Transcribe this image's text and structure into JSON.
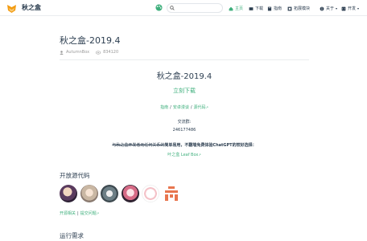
{
  "nav": {
    "site_name": "秋之盒",
    "search_placeholder": "",
    "items": [
      {
        "label": "主页",
        "active": true
      },
      {
        "label": "下载"
      },
      {
        "label": "指南"
      },
      {
        "label": "拓展模块"
      },
      {
        "label": "关于"
      },
      {
        "label": "开发"
      }
    ]
  },
  "page": {
    "title": "秋之盒-2019.4",
    "author": "AutumnBox",
    "views": "834120"
  },
  "content": {
    "heading": "秋之盒-2019.4",
    "download": "立刻下载",
    "links": [
      "指南",
      "安卓漫谈",
      "源代码"
    ],
    "group_label": "交流群:",
    "group_number": "246177486",
    "notice_strike": "与秋之盒开发者无任何关系的",
    "notice_bold": "简单易用，不翻墙免费体验ChatGPT的较好选择：",
    "leaf_link": "叶之盒 Leaf Box"
  },
  "oss": {
    "title": "开放源代码",
    "links": [
      "开源相关",
      "提交问题"
    ]
  },
  "runtime": {
    "title": "运行需求"
  },
  "colors": {
    "accent": "#3eaf7c",
    "text": "#2c3e50",
    "muted": "#999999"
  }
}
